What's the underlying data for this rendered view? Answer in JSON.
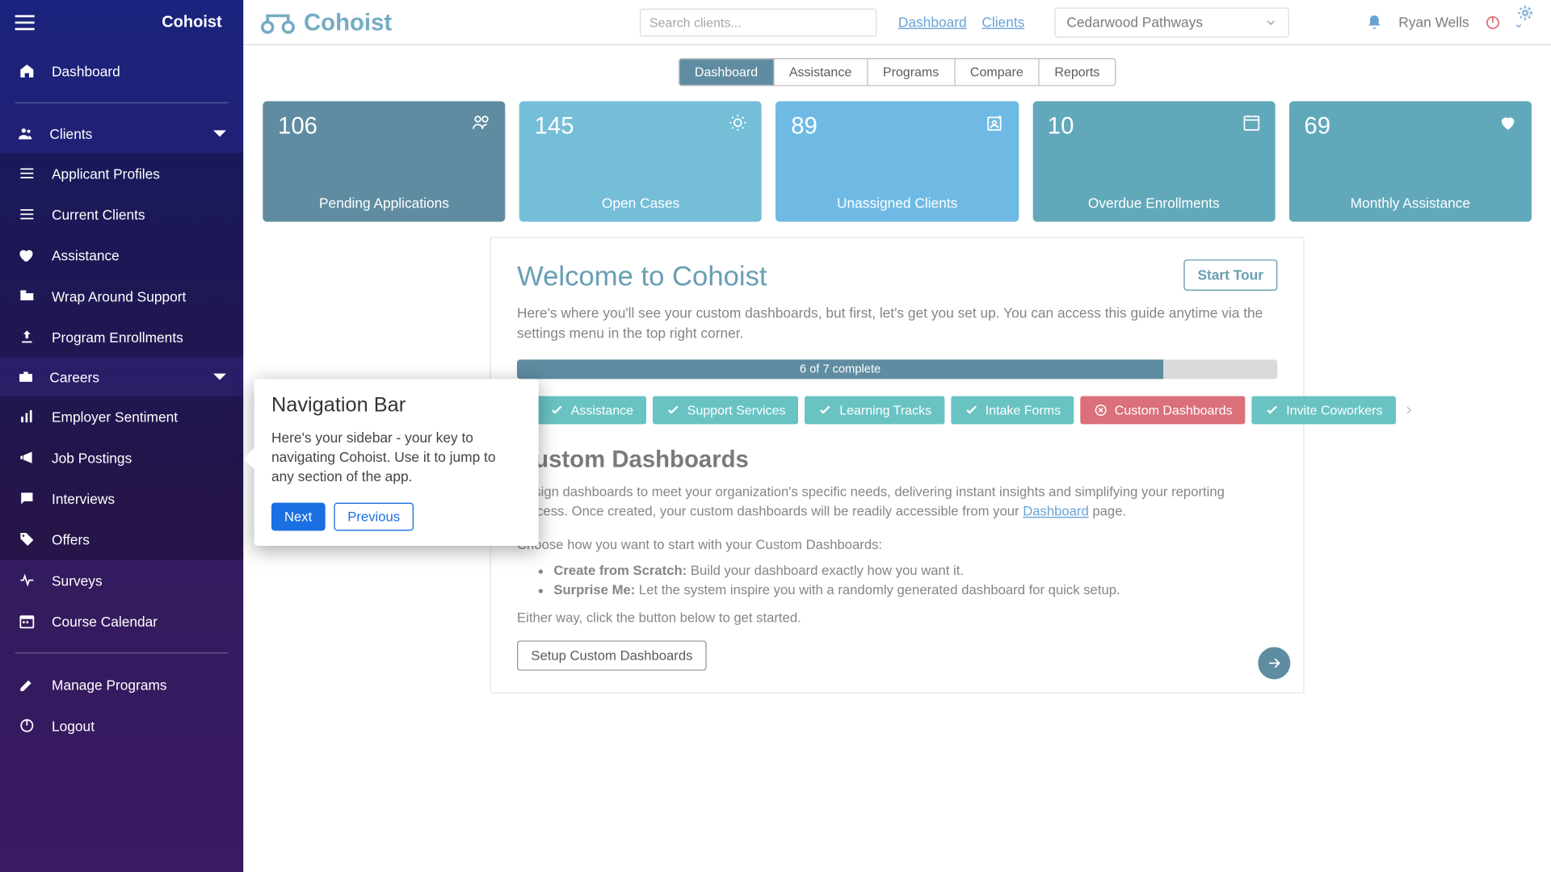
{
  "brand": {
    "name": "Cohoist",
    "mini": "Cohoist"
  },
  "sidebar": {
    "dashboard": "Dashboard",
    "group_clients": "Clients",
    "clients_items": [
      "Applicant Profiles",
      "Current Clients",
      "Assistance",
      "Wrap Around Support",
      "Program Enrollments"
    ],
    "group_careers": "Careers",
    "careers_items": [
      "Employer Sentiment",
      "Job Postings",
      "Interviews",
      "Offers"
    ],
    "surveys": "Surveys",
    "calendar": "Course Calendar",
    "manage": "Manage Programs",
    "logout": "Logout"
  },
  "topbar": {
    "search_placeholder": "Search clients...",
    "links": [
      "Dashboard",
      "Clients"
    ],
    "org": "Cedarwood Pathways",
    "user": "Ryan Wells"
  },
  "tabs": [
    "Dashboard",
    "Assistance",
    "Programs",
    "Compare",
    "Reports"
  ],
  "cards": [
    {
      "num": "106",
      "label": "Pending Applications",
      "cls": "c-blue1"
    },
    {
      "num": "145",
      "label": "Open Cases",
      "cls": "c-blue2"
    },
    {
      "num": "89",
      "label": "Unassigned Clients",
      "cls": "c-blue3"
    },
    {
      "num": "10",
      "label": "Overdue Enrollments",
      "cls": "c-teal"
    },
    {
      "num": "69",
      "label": "Monthly Assistance",
      "cls": "c-teal"
    }
  ],
  "panel": {
    "title": "Welcome to Cohoist",
    "desc": "Here's where you'll see your custom dashboards, but first, let's get you set up. You can access this guide anytime via the settings menu in the top right corner.",
    "start_tour": "Start Tour",
    "progress": "6 of 7 complete",
    "chips": [
      "Assistance",
      "Support Services",
      "Learning Tracks",
      "Intake Forms",
      "Custom Dashboards",
      "Invite Coworkers"
    ],
    "section_title": "Custom Dashboards",
    "section_text_a": "Design dashboards to meet your organization's specific needs, delivering instant insights and simplifying your reporting process. Once created, your custom dashboards will be readily accessible from your ",
    "section_link": "Dashboard",
    "section_text_b": " page.",
    "section_sub": "Choose how you want to start with your Custom Dashboards:",
    "bullets": [
      {
        "b": "Create from Scratch:",
        "t": " Build your dashboard exactly how you want it."
      },
      {
        "b": "Surprise Me:",
        "t": " Let the system inspire you with a randomly generated dashboard for quick setup."
      }
    ],
    "foot": "Either way, click the button below to get started.",
    "setup_btn": "Setup Custom Dashboards"
  },
  "tour": {
    "title": "Navigation Bar",
    "body": "Here's your sidebar - your key to navigating Cohoist. Use it to jump to any section of the app.",
    "next": "Next",
    "previous": "Previous"
  }
}
